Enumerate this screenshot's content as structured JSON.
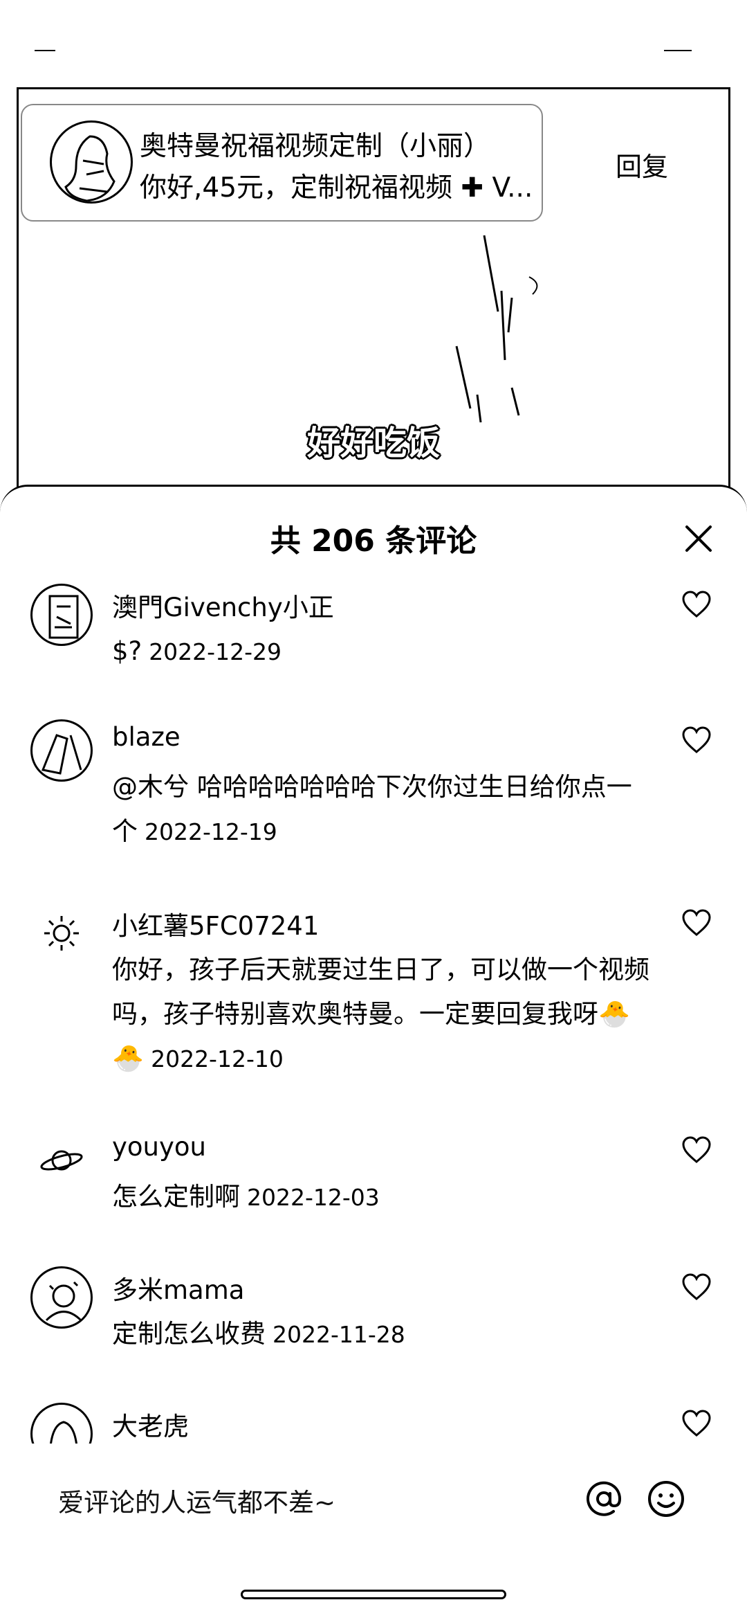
{
  "pinned": {
    "title": "奥特曼祝福视频定制（小丽）",
    "message": "你好,45元，定制祝福视频 ✚ V...",
    "reply_label": "回复"
  },
  "video": {
    "subtitle": "好好吃饭"
  },
  "sheet": {
    "title": "共 206 条评论",
    "close_icon": "close-icon"
  },
  "comments": [
    {
      "name": "澳門Givenchy小正",
      "text": "$?",
      "date": "2022-12-29",
      "avatar": "photo"
    },
    {
      "name": "blaze",
      "text": "@木兮 哈哈哈哈哈哈哈下次你过生日给你点一个",
      "date": "2022-12-19",
      "avatar": "photo"
    },
    {
      "name": "小红薯5FC07241",
      "text": "你好，孩子后天就要过生日了，可以做一个视频吗，孩子特别喜欢奥特曼。一定要回复我呀",
      "emoji": "🐣🐣",
      "date": "2022-12-10",
      "avatar": "sun-icon"
    },
    {
      "name": "youyou",
      "text": "怎么定制啊",
      "date": "2022-12-03",
      "avatar": "planet-icon"
    },
    {
      "name": "多米mama",
      "text": "定制怎么收费",
      "date": "2022-11-28",
      "avatar": "photo"
    },
    {
      "name": "大老虎",
      "text": "",
      "date": "",
      "avatar": "photo"
    }
  ],
  "input": {
    "placeholder": "爱评论的人运气都不差~",
    "at_icon": "at-icon",
    "emoji_icon": "emoji-icon"
  }
}
